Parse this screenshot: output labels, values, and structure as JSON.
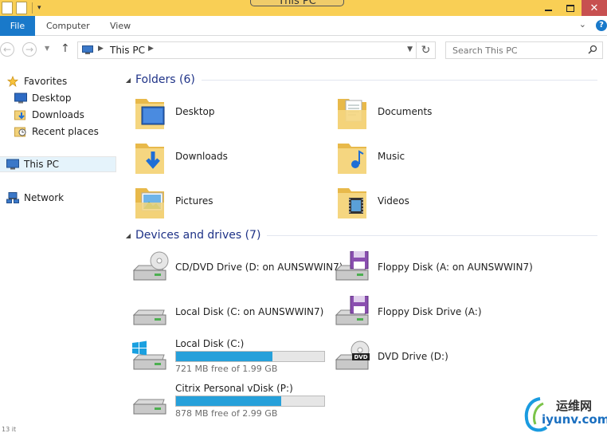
{
  "window": {
    "title": "This PC"
  },
  "ribbon": {
    "tabs": [
      "File",
      "Computer",
      "View"
    ]
  },
  "address": {
    "location": "This PC",
    "search_placeholder": "Search This PC"
  },
  "nav": {
    "favorites_label": "Favorites",
    "favorites": [
      "Desktop",
      "Downloads",
      "Recent places"
    ],
    "this_pc": "This PC",
    "network": "Network"
  },
  "folders": {
    "header": "Folders (6)",
    "items": [
      "Desktop",
      "Documents",
      "Downloads",
      "Music",
      "Pictures",
      "Videos"
    ]
  },
  "drives": {
    "header": "Devices and drives (7)",
    "items": [
      {
        "name": "CD/DVD Drive (D: on AUNSWWIN7)",
        "icon": "cd-drive-icon"
      },
      {
        "name": "Floppy Disk (A: on AUNSWWIN7)",
        "icon": "floppy-drive-icon"
      },
      {
        "name": "Local Disk (C: on AUNSWWIN7)",
        "icon": "hard-disk-icon"
      },
      {
        "name": "Floppy Disk Drive (A:)",
        "icon": "floppy-drive-icon"
      },
      {
        "name": "Local Disk (C:)",
        "icon": "windows-disk-icon",
        "free_text": "721 MB free of 1.99 GB",
        "used_fraction": 0.65
      },
      {
        "name": "DVD Drive (D:)",
        "icon": "dvd-drive-icon"
      },
      {
        "name": "Citrix Personal vDisk (P:)",
        "icon": "hard-disk-icon",
        "free_text": "878 MB free of 2.99 GB",
        "used_fraction": 0.71
      }
    ]
  },
  "status": {
    "text": "13 it"
  },
  "watermark": {
    "cn": "运维网",
    "en": "iyunv.com"
  },
  "colors": {
    "title_bar": "#f9cf55",
    "file_tab": "#1979ca",
    "group_header": "#1e3287",
    "capacity_fill": "#26a0da"
  }
}
